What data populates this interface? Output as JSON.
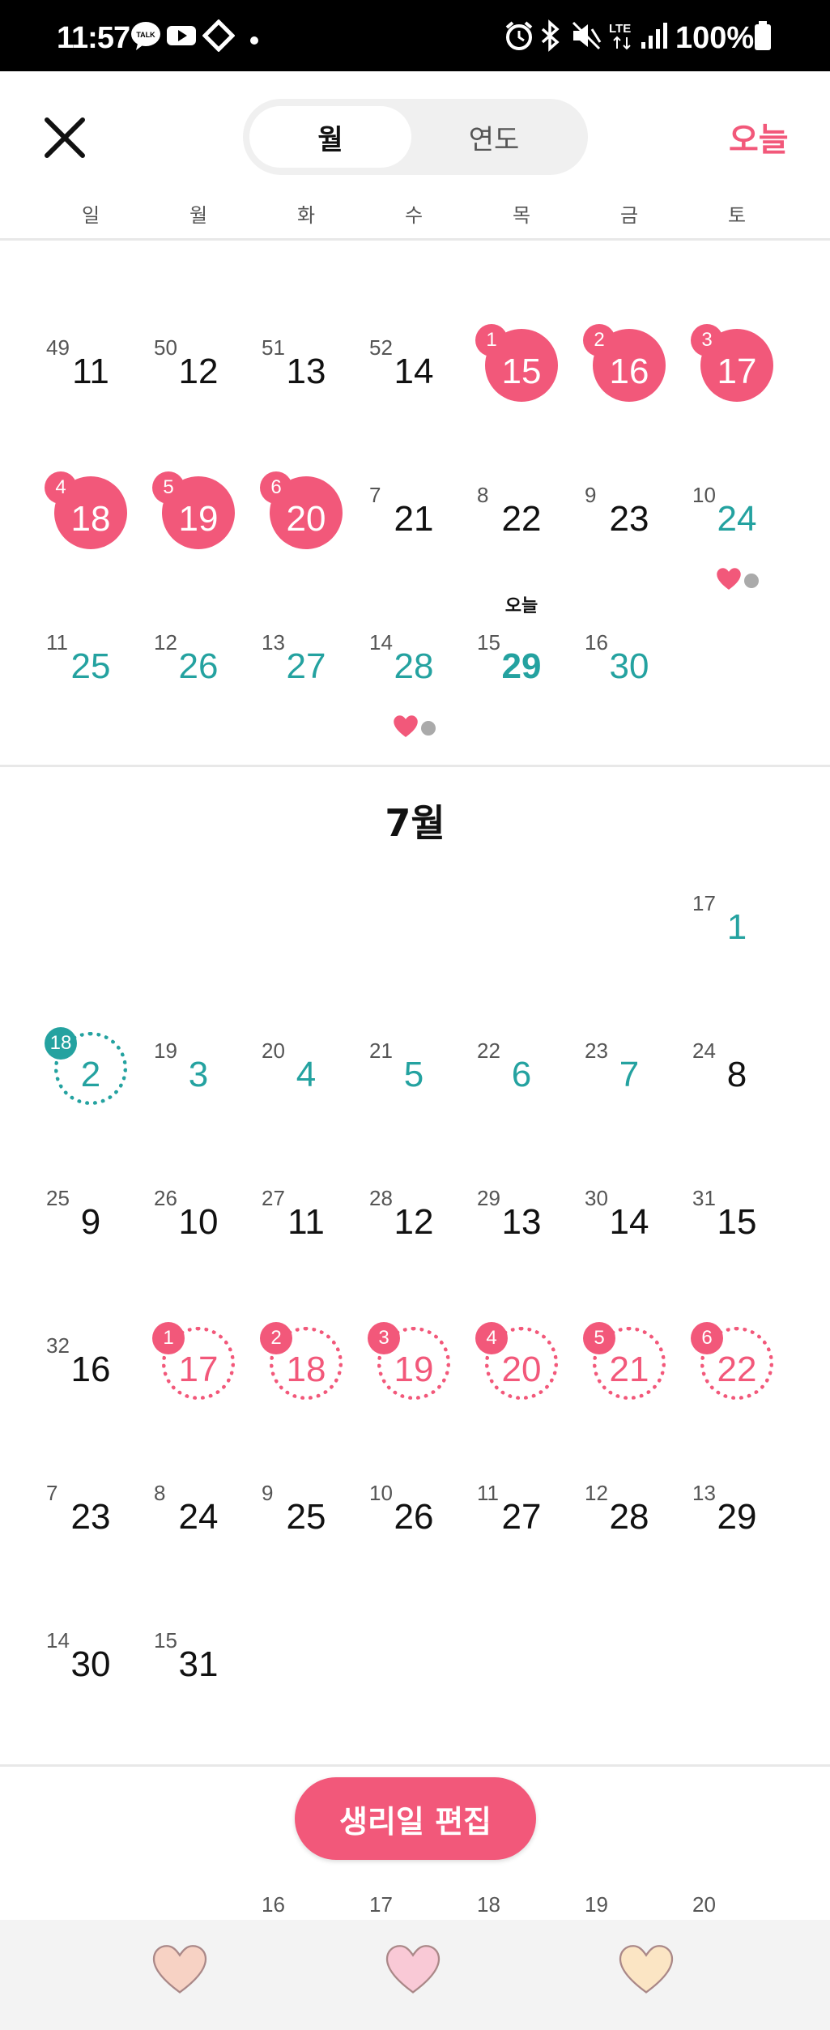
{
  "status": {
    "time": "11:57",
    "battery": "100%",
    "icons": [
      "talk-icon",
      "youtube-icon",
      "diamond-icon",
      "dot-icon",
      "alarm-icon",
      "bluetooth-icon",
      "mute-icon",
      "lte-icon",
      "signal-icon",
      "battery-icon"
    ]
  },
  "header": {
    "close_icon": "close-icon",
    "tab_month": "월",
    "tab_year": "연도",
    "today_button": "오늘"
  },
  "weekdays": [
    "일",
    "월",
    "화",
    "수",
    "목",
    "금",
    "토"
  ],
  "june": {
    "today_label": "오늘",
    "rows": [
      [
        {
          "cycle": "49",
          "day": "11",
          "style": "plain"
        },
        {
          "cycle": "50",
          "day": "12",
          "style": "plain"
        },
        {
          "cycle": "51",
          "day": "13",
          "style": "plain"
        },
        {
          "cycle": "52",
          "day": "14",
          "style": "plain"
        },
        {
          "cycle": "1",
          "day": "15",
          "style": "period"
        },
        {
          "cycle": "2",
          "day": "16",
          "style": "period"
        },
        {
          "cycle": "3",
          "day": "17",
          "style": "period"
        }
      ],
      [
        {
          "cycle": "4",
          "day": "18",
          "style": "period"
        },
        {
          "cycle": "5",
          "day": "19",
          "style": "period"
        },
        {
          "cycle": "6",
          "day": "20",
          "style": "period"
        },
        {
          "cycle": "7",
          "day": "21",
          "style": "plain"
        },
        {
          "cycle": "8",
          "day": "22",
          "style": "plain"
        },
        {
          "cycle": "9",
          "day": "23",
          "style": "plain"
        },
        {
          "cycle": "10",
          "day": "24",
          "style": "teal",
          "marks": true
        }
      ],
      [
        {
          "cycle": "11",
          "day": "25",
          "style": "teal"
        },
        {
          "cycle": "12",
          "day": "26",
          "style": "teal"
        },
        {
          "cycle": "13",
          "day": "27",
          "style": "teal"
        },
        {
          "cycle": "14",
          "day": "28",
          "style": "teal",
          "marks": true
        },
        {
          "cycle": "15",
          "day": "29",
          "style": "today"
        },
        {
          "cycle": "16",
          "day": "30",
          "style": "teal"
        }
      ]
    ]
  },
  "july": {
    "title": "7월",
    "rows": [
      [
        null,
        null,
        null,
        null,
        null,
        null,
        {
          "cycle": "17",
          "day": "1",
          "style": "teal"
        }
      ],
      [
        {
          "cycle": "18",
          "day": "2",
          "style": "ovulation"
        },
        {
          "cycle": "19",
          "day": "3",
          "style": "teal"
        },
        {
          "cycle": "20",
          "day": "4",
          "style": "teal"
        },
        {
          "cycle": "21",
          "day": "5",
          "style": "teal"
        },
        {
          "cycle": "22",
          "day": "6",
          "style": "teal"
        },
        {
          "cycle": "23",
          "day": "7",
          "style": "teal"
        },
        {
          "cycle": "24",
          "day": "8",
          "style": "plain"
        }
      ],
      [
        {
          "cycle": "25",
          "day": "9",
          "style": "plain"
        },
        {
          "cycle": "26",
          "day": "10",
          "style": "plain"
        },
        {
          "cycle": "27",
          "day": "11",
          "style": "plain"
        },
        {
          "cycle": "28",
          "day": "12",
          "style": "plain"
        },
        {
          "cycle": "29",
          "day": "13",
          "style": "plain"
        },
        {
          "cycle": "30",
          "day": "14",
          "style": "plain"
        },
        {
          "cycle": "31",
          "day": "15",
          "style": "plain"
        }
      ],
      [
        {
          "cycle": "32",
          "day": "16",
          "style": "plain"
        },
        {
          "cycle": "1",
          "day": "17",
          "style": "predicted"
        },
        {
          "cycle": "2",
          "day": "18",
          "style": "predicted"
        },
        {
          "cycle": "3",
          "day": "19",
          "style": "predicted"
        },
        {
          "cycle": "4",
          "day": "20",
          "style": "predicted"
        },
        {
          "cycle": "5",
          "day": "21",
          "style": "predicted"
        },
        {
          "cycle": "6",
          "day": "22",
          "style": "predicted"
        }
      ],
      [
        {
          "cycle": "7",
          "day": "23",
          "style": "plain"
        },
        {
          "cycle": "8",
          "day": "24",
          "style": "plain"
        },
        {
          "cycle": "9",
          "day": "25",
          "style": "plain"
        },
        {
          "cycle": "10",
          "day": "26",
          "style": "plain"
        },
        {
          "cycle": "11",
          "day": "27",
          "style": "plain"
        },
        {
          "cycle": "12",
          "day": "28",
          "style": "plain"
        },
        {
          "cycle": "13",
          "day": "29",
          "style": "plain"
        }
      ],
      [
        {
          "cycle": "14",
          "day": "30",
          "style": "plain"
        },
        {
          "cycle": "15",
          "day": "31",
          "style": "plain"
        }
      ]
    ]
  },
  "partial_cycles": [
    "16",
    "17",
    "18",
    "19",
    "20"
  ],
  "edit_button": "생리일 편집",
  "bottom_nav": [
    {
      "icon": "heart-icon",
      "color": "#f7d2c4"
    },
    {
      "icon": "heart-icon",
      "color": "#f9c9d6"
    },
    {
      "icon": "heart-icon",
      "color": "#fbe5c4"
    }
  ],
  "colors": {
    "accent": "#f2587a",
    "teal": "#24a2a0"
  }
}
